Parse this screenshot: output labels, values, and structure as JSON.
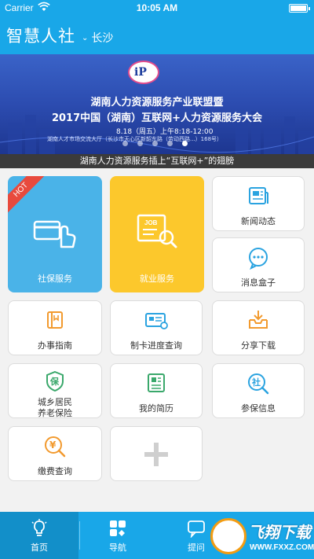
{
  "status_bar": {
    "carrier": "Carrier",
    "time": "10:05 AM"
  },
  "header": {
    "title": "智慧人社",
    "city": "长沙",
    "chevron": "⌄"
  },
  "banner": {
    "logo_text": "iP",
    "line1": "湖南人力资源服务产业联盟暨",
    "line2": "2017中国（湖南）互联网+人力资源服务大会",
    "line3": "8.18（周五）上午8:18-12:00",
    "line4": "湖南人才市场交流大厅（长沙市天心区新韶东路（劳动西路...）168号）",
    "caption": "湖南人力资源服务插上“互联网+”的翅膀",
    "dot_count": 5,
    "active_dot": 4
  },
  "tiles": {
    "shebao": {
      "label": "社保服务",
      "badge": "HOT",
      "color": "#4ab3e8"
    },
    "jiuye": {
      "label": "就业服务",
      "color": "#fcc82c"
    },
    "news": {
      "label": "新闻动态"
    },
    "messages": {
      "label": "消息盒子"
    },
    "guide": {
      "label": "办事指南"
    },
    "card_progress": {
      "label": "制卡进度查询"
    },
    "share": {
      "label": "分享下载"
    },
    "pension_line1": {
      "label": "城乡居民"
    },
    "pension_line2": {
      "label": "养老保险"
    },
    "resume": {
      "label": "我的简历"
    },
    "insurance_info": {
      "label": "参保信息"
    },
    "payment": {
      "label": "缴费查询"
    }
  },
  "tab_bar": {
    "tabs": [
      {
        "label": "首页",
        "icon": "lightbulb-icon",
        "active": true
      },
      {
        "label": "导航",
        "icon": "grid-icon",
        "active": false
      },
      {
        "label": "提问",
        "icon": "chat-icon",
        "active": false
      }
    ]
  },
  "watermark": {
    "text": "飞翔下载",
    "url": "WWW.FXXZ.COM"
  },
  "colors": {
    "primary": "#19a7e8",
    "icon_blue": "#2aa3e0",
    "icon_orange": "#f29a2e",
    "icon_green": "#3aa86b"
  }
}
